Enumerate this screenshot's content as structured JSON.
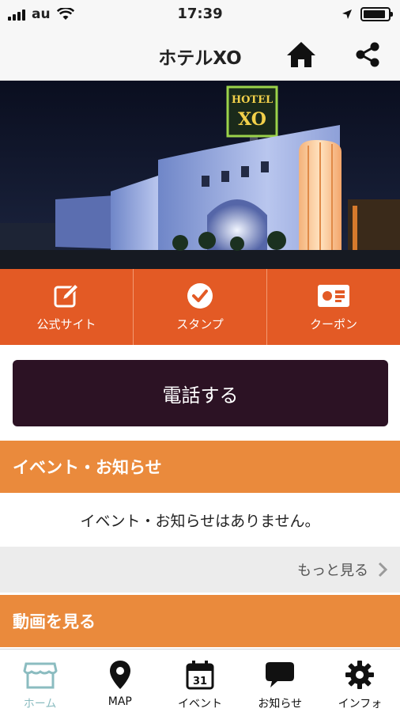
{
  "status_bar": {
    "carrier": "au",
    "time": "17:39",
    "battery_level": 0.9
  },
  "header": {
    "title": "ホテルXO"
  },
  "hero": {
    "sign_top": "HOTEL",
    "sign_main": "XO"
  },
  "tiles": [
    {
      "label": "公式サイト",
      "icon": "edit-icon"
    },
    {
      "label": "スタンプ",
      "icon": "check-badge-icon"
    },
    {
      "label": "クーポン",
      "icon": "coupon-icon"
    }
  ],
  "call_button": {
    "label": "電話する"
  },
  "events": {
    "title": "イベント・お知らせ",
    "empty_message": "イベント・お知らせはありません。",
    "more_label": "もっと見る"
  },
  "videos": {
    "title": "動画を見る"
  },
  "tab_bar": {
    "tabs": [
      {
        "label": "ホーム",
        "icon": "store-icon",
        "active": true
      },
      {
        "label": "MAP",
        "icon": "map-pin-icon",
        "active": false
      },
      {
        "label": "イベント",
        "icon": "calendar-icon",
        "calendar_day": "31",
        "active": false
      },
      {
        "label": "お知らせ",
        "icon": "chat-bubble-icon",
        "active": false
      },
      {
        "label": "インフォ",
        "icon": "gear-icon",
        "active": false
      }
    ]
  },
  "colors": {
    "tile_orange": "#e35a25",
    "section_orange": "#ea8a3c",
    "call_button": "#2c1224",
    "active_tab": "#8bbcc0"
  }
}
